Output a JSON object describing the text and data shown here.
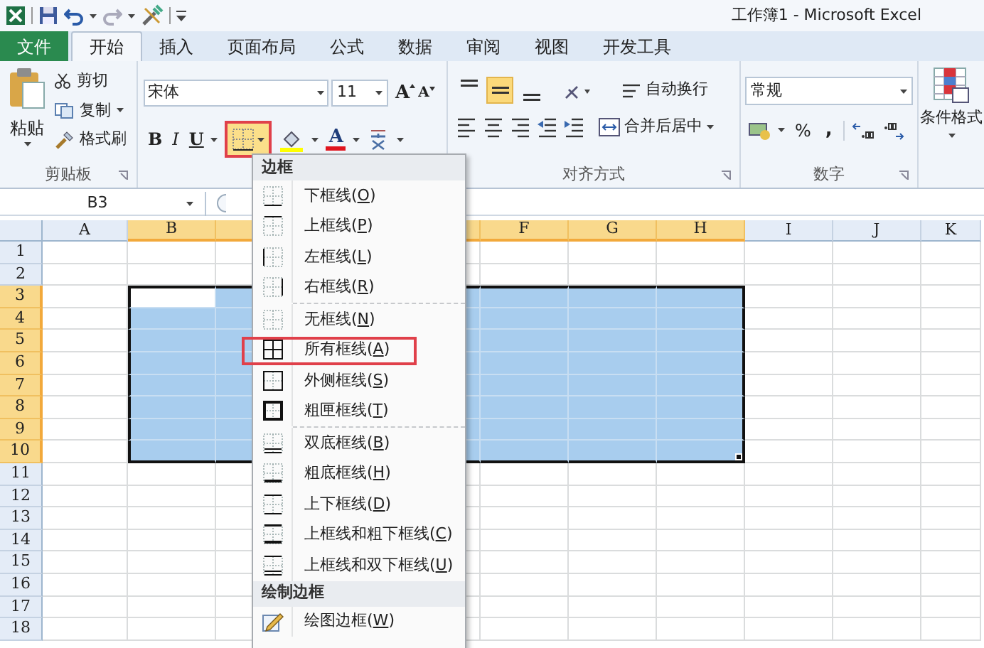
{
  "window": {
    "title": "工作簿1 - Microsoft Excel"
  },
  "ribbon_tabs": [
    {
      "label": "文件",
      "kind": "file",
      "selected": false
    },
    {
      "label": "开始",
      "kind": "tab",
      "selected": true
    },
    {
      "label": "插入",
      "kind": "tab",
      "selected": false
    },
    {
      "label": "页面布局",
      "kind": "tab",
      "selected": false
    },
    {
      "label": "公式",
      "kind": "tab",
      "selected": false
    },
    {
      "label": "数据",
      "kind": "tab",
      "selected": false
    },
    {
      "label": "审阅",
      "kind": "tab",
      "selected": false
    },
    {
      "label": "视图",
      "kind": "tab",
      "selected": false
    },
    {
      "label": "开发工具",
      "kind": "tab",
      "selected": false
    }
  ],
  "clipboard": {
    "label": "剪贴板",
    "paste": "粘贴",
    "cut": "剪切",
    "copy": "复制",
    "format_painter": "格式刷"
  },
  "font": {
    "name": "宋体",
    "size": "11",
    "grow": "A",
    "shrink": "A",
    "bold": "B",
    "italic": "I",
    "underline": "U",
    "borders_highlighted": true,
    "font_color": "A"
  },
  "alignment": {
    "label": "对齐方式",
    "vertical": [
      {
        "kind": "top",
        "selected": false
      },
      {
        "kind": "middle",
        "selected": true
      },
      {
        "kind": "bottom",
        "selected": false
      }
    ],
    "wrap_text": "自动换行",
    "merge_center": "合并后居中"
  },
  "number": {
    "label": "数字",
    "format": "常规",
    "percent": "%",
    "comma": ","
  },
  "styles": {
    "conditional_formatting": "条件格式"
  },
  "formula_bar": {
    "name_box": "B3"
  },
  "sheet": {
    "columns": [
      {
        "letter": "A",
        "selected": false
      },
      {
        "letter": "B",
        "selected": true
      },
      {
        "selected": true
      },
      {
        "selected": true
      },
      {
        "letter": "F",
        "selected": true
      },
      {
        "letter": "G",
        "selected": true
      },
      {
        "letter": "H",
        "selected": true
      },
      {
        "letter": "I",
        "selected": false
      },
      {
        "letter": "J",
        "selected": false
      },
      {
        "letter": "K",
        "selected": false
      }
    ],
    "rows": [
      {
        "number": "1",
        "selected": false
      },
      {
        "number": "2",
        "selected": false
      },
      {
        "number": "3",
        "selected": true
      },
      {
        "number": "4",
        "selected": true
      },
      {
        "number": "5",
        "selected": true
      },
      {
        "number": "6",
        "selected": true
      },
      {
        "number": "7",
        "selected": true
      },
      {
        "number": "8",
        "selected": true
      },
      {
        "number": "9",
        "selected": true
      },
      {
        "number": "10",
        "selected": true
      },
      {
        "number": "11",
        "selected": false
      },
      {
        "number": "12",
        "selected": false
      },
      {
        "number": "13",
        "selected": false
      },
      {
        "number": "14",
        "selected": false
      },
      {
        "number": "15",
        "selected": false
      },
      {
        "number": "16",
        "selected": false
      },
      {
        "number": "17",
        "selected": false
      },
      {
        "number": "18",
        "selected": false
      }
    ]
  },
  "borders_menu": {
    "sections": [
      {
        "title": "边框",
        "groups": [
          [
            {
              "label": "下框线(O)",
              "kind": "bottom",
              "highlighted": false
            },
            {
              "label": "上框线(P)",
              "kind": "top",
              "highlighted": false
            },
            {
              "label": "左框线(L)",
              "kind": "left",
              "highlighted": false
            },
            {
              "label": "右框线(R)",
              "kind": "right",
              "highlighted": false
            }
          ],
          [
            {
              "label": "无框线(N)",
              "kind": "none",
              "highlighted": false
            },
            {
              "label": "所有框线(A)",
              "kind": "all",
              "highlighted": true
            },
            {
              "label": "外侧框线(S)",
              "kind": "outside",
              "highlighted": false
            },
            {
              "label": "粗匣框线(T)",
              "kind": "thick",
              "highlighted": false
            }
          ],
          [
            {
              "label": "双底框线(B)",
              "kind": "double_bottom",
              "highlighted": false
            },
            {
              "label": "粗底框线(H)",
              "kind": "thick_bottom",
              "highlighted": false
            },
            {
              "label": "上下框线(D)",
              "kind": "top_bottom",
              "highlighted": false
            },
            {
              "label": "上框线和粗下框线(C)",
              "kind": "top_thick_bottom",
              "highlighted": false
            },
            {
              "label": "上框线和双下框线(U)",
              "kind": "top_double_bottom",
              "highlighted": false
            }
          ]
        ]
      },
      {
        "title": "绘制边框",
        "groups": [
          [
            {
              "label": "绘图边框(W)",
              "kind": "draw",
              "highlighted": false
            }
          ]
        ]
      }
    ]
  }
}
